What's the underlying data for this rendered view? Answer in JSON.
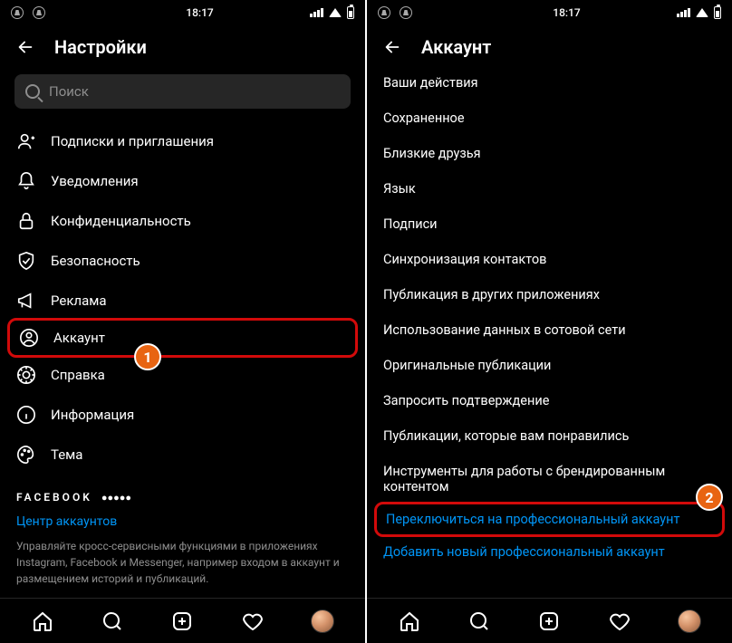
{
  "statusbar": {
    "time": "18:17"
  },
  "left": {
    "title": "Настройки",
    "search_placeholder": "Поиск",
    "items": [
      {
        "label": "Подписки и приглашения"
      },
      {
        "label": "Уведомления"
      },
      {
        "label": "Конфиденциальность"
      },
      {
        "label": "Безопасность"
      },
      {
        "label": "Реклама"
      },
      {
        "label": "Аккаунт"
      },
      {
        "label": "Справка"
      },
      {
        "label": "Информация"
      },
      {
        "label": "Тема"
      }
    ],
    "fb_brand": "FACEBOOK",
    "accounts_center": "Центр аккаунтов",
    "description": "Управляйте кросс-сервисными функциями в приложениях Instagram, Facebook и Messenger, например входом в аккаунт и размещением историй и публикаций.",
    "badge1": "1"
  },
  "right": {
    "title": "Аккаунт",
    "items": [
      {
        "label": "Ваши действия"
      },
      {
        "label": "Сохраненное"
      },
      {
        "label": "Близкие друзья"
      },
      {
        "label": "Язык"
      },
      {
        "label": "Подписи"
      },
      {
        "label": "Синхронизация контактов"
      },
      {
        "label": "Публикация в других приложениях"
      },
      {
        "label": "Использование данных в сотовой сети"
      },
      {
        "label": "Оригинальные публикации"
      },
      {
        "label": "Запросить подтверждение"
      },
      {
        "label": "Публикации, которые вам понравились"
      },
      {
        "label": "Инструменты для работы с брендированным контентом"
      },
      {
        "label": "Переключиться на профессиональный аккаунт"
      },
      {
        "label": "Добавить новый профессиональный аккаунт"
      }
    ],
    "badge2": "2"
  }
}
